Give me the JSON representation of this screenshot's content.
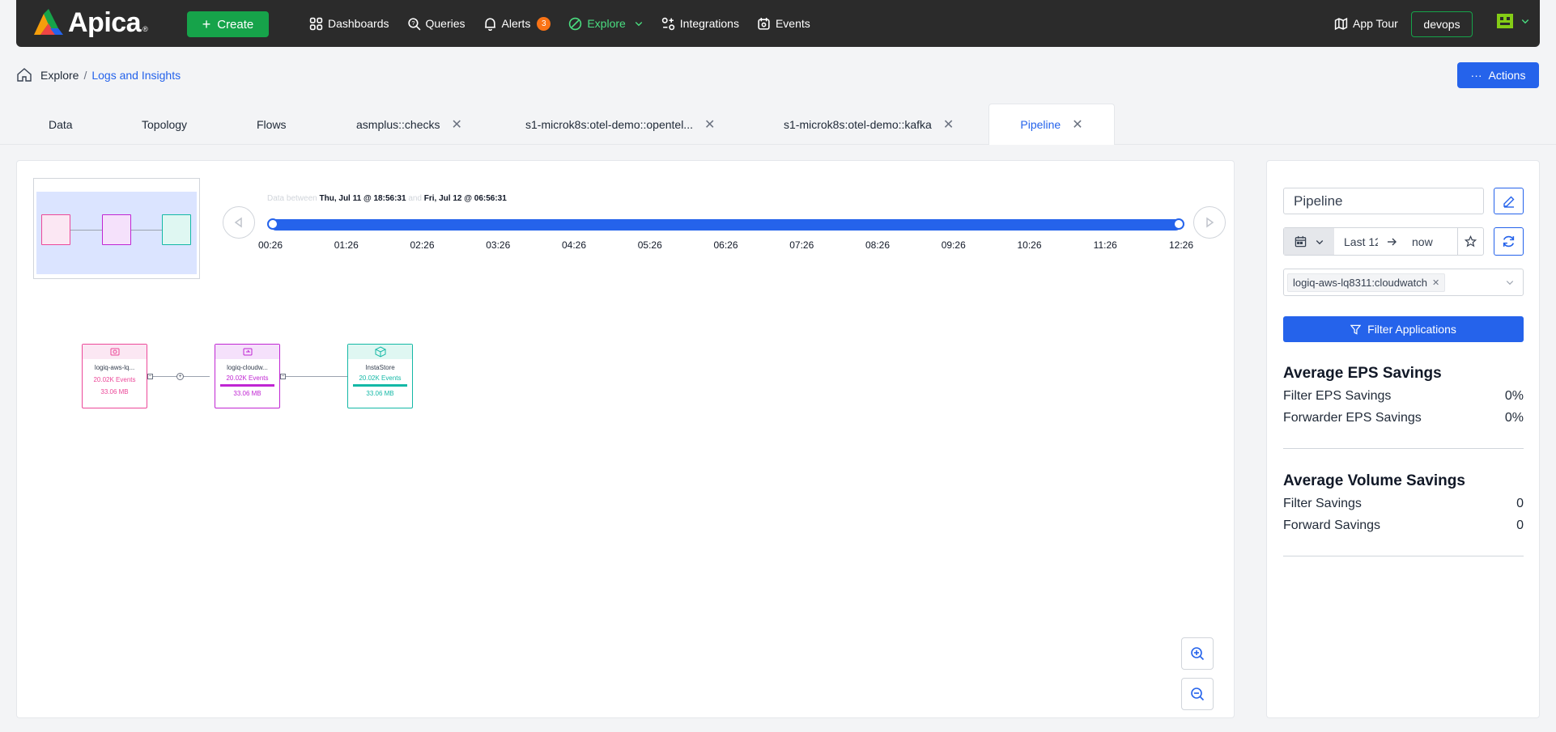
{
  "brand": {
    "name": "Apica"
  },
  "topbar": {
    "create_label": "Create",
    "nav": [
      {
        "label": "Dashboards",
        "icon": "dashboards-icon"
      },
      {
        "label": "Queries",
        "icon": "queries-icon"
      },
      {
        "label": "Alerts",
        "icon": "bell-icon",
        "badge": "3"
      },
      {
        "label": "Explore",
        "icon": "explore-icon",
        "active": true
      },
      {
        "label": "Integrations",
        "icon": "integrations-icon"
      },
      {
        "label": "Events",
        "icon": "events-icon"
      }
    ],
    "app_tour_label": "App Tour",
    "workspace_label": "devops"
  },
  "breadcrumb": {
    "root": "Explore",
    "separator": "/",
    "current": "Logs and Insights"
  },
  "actions_label": "Actions",
  "tabs": [
    {
      "label": "Data",
      "closable": false
    },
    {
      "label": "Topology",
      "closable": false
    },
    {
      "label": "Flows",
      "closable": false
    },
    {
      "label": "asmplus::checks",
      "closable": true
    },
    {
      "label": "s1-microk8s:otel-demo::opentel...",
      "closable": true
    },
    {
      "label": "s1-microk8s:otel-demo::kafka",
      "closable": true
    },
    {
      "label": "Pipeline",
      "closable": true,
      "active": true
    }
  ],
  "timeline": {
    "prefix": "Data between",
    "start": "Thu, Jul 11 @ 18:56:31",
    "conjunction": "and",
    "end": "Fri, Jul 12 @ 06:56:31",
    "ticks": [
      "00:26",
      "01:26",
      "02:26",
      "03:26",
      "04:26",
      "05:26",
      "06:26",
      "07:26",
      "08:26",
      "09:26",
      "10:26",
      "11:26",
      "12:26"
    ]
  },
  "pipeline_nodes": [
    {
      "name": "logiq-aws-lq...",
      "events": "20.02K Events",
      "size": "33.06 MB",
      "color": "#ec4899",
      "icon": "source-icon"
    },
    {
      "name": "logiq-cloudw...",
      "events": "20.02K Events",
      "size": "33.06 MB",
      "color": "#c026d3",
      "icon": "forwarder-icon"
    },
    {
      "name": "InstaStore",
      "events": "20.02K Events",
      "size": "33.06 MB",
      "color": "#14b8a6",
      "icon": "store-icon"
    }
  ],
  "sidebar": {
    "pipeline_name": "Pipeline",
    "time_range": {
      "from": "Last 12",
      "to": "now"
    },
    "selected_app": "logiq-aws-lq8311:cloudwatch",
    "filter_label": "Filter Applications",
    "eps": {
      "title": "Average EPS Savings",
      "rows": [
        {
          "label": "Filter EPS Savings",
          "value": "0%"
        },
        {
          "label": "Forwarder EPS Savings",
          "value": "0%"
        }
      ]
    },
    "volume": {
      "title": "Average Volume Savings",
      "rows": [
        {
          "label": "Filter Savings",
          "value": "0"
        },
        {
          "label": "Forward Savings",
          "value": "0"
        }
      ]
    }
  },
  "colors": {
    "accent": "#2563eb",
    "create": "#16a34a",
    "explore_active": "#4ade80",
    "alert_badge": "#f97316"
  }
}
